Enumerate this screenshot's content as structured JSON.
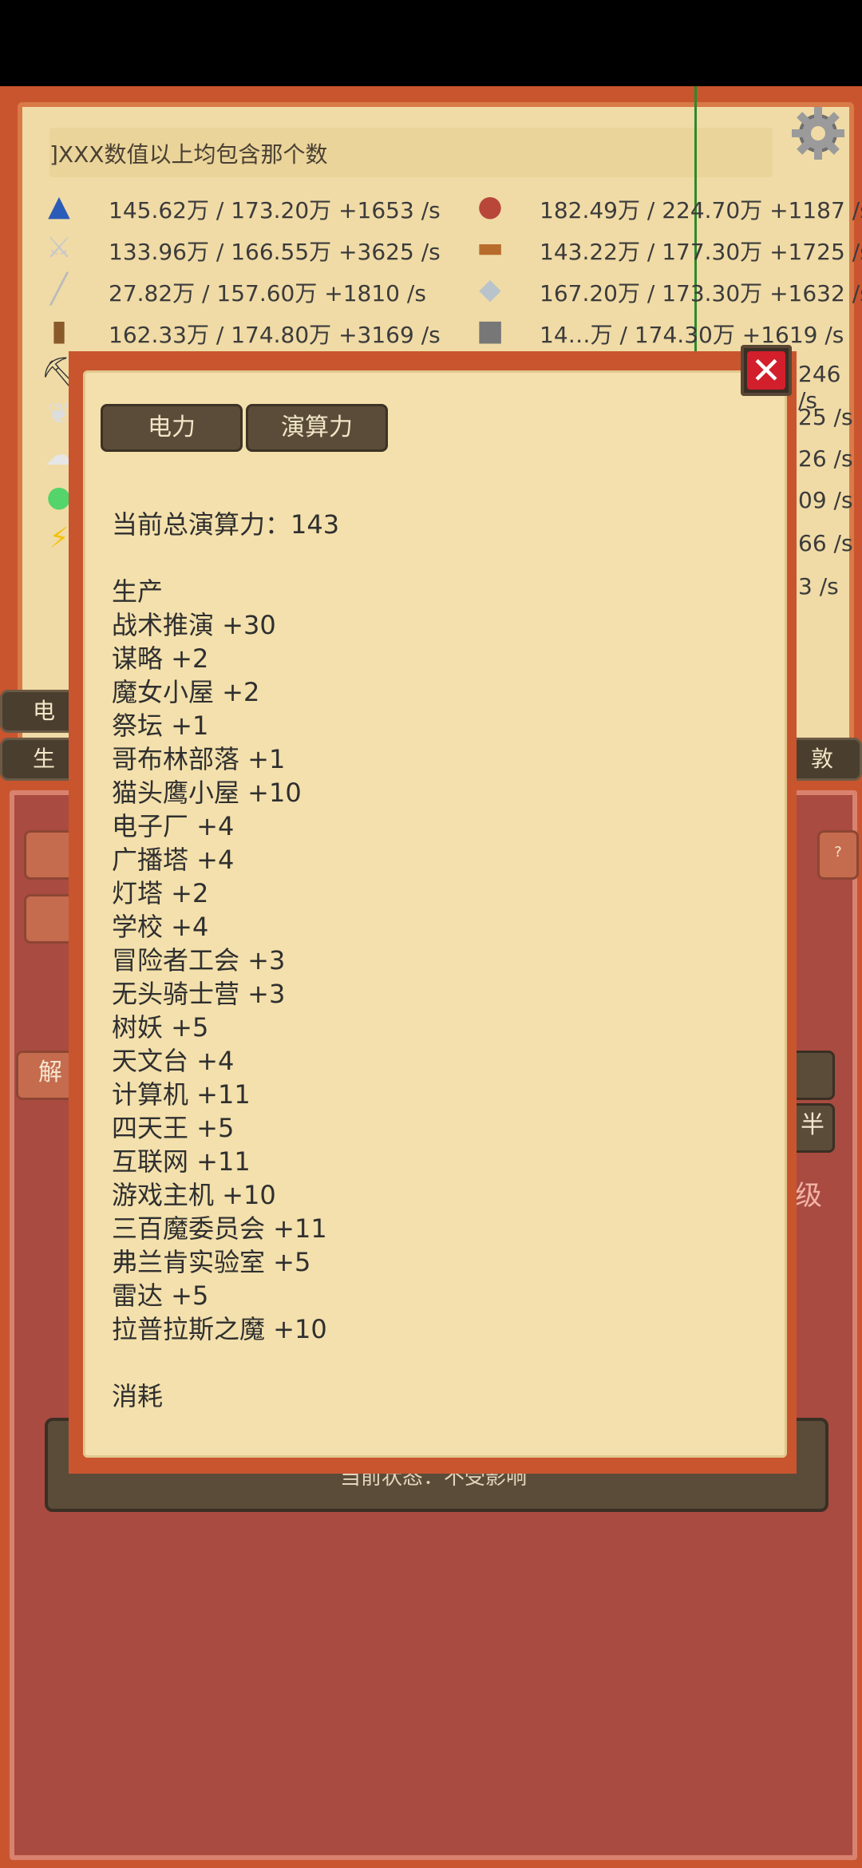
{
  "info_text": "]XXX数值以上均包含那个数",
  "left_resources": [
    {
      "icon": "wizard-hat-icon",
      "text": "145.62万 / 173.20万  +1653 /s"
    },
    {
      "icon": "sword-icon",
      "text": "133.96万 / 166.55万  +3625 /s"
    },
    {
      "icon": "wand-icon",
      "text": "27.82万 / 157.60万  +1810 /s"
    },
    {
      "icon": "book-icon",
      "text": "162.33万 / 174.80万  +3169 /s"
    }
  ],
  "right_resources": [
    {
      "icon": "meat-icon",
      "text": "182.49万 / 224.70万  +1187 /s"
    },
    {
      "icon": "wood-log-icon",
      "text": "143.22万 / 177.30万  +1725 /s"
    },
    {
      "icon": "crystal-icon",
      "text": "167.20万 / 173.30万  +1632 /s"
    },
    {
      "icon": "iron-ingot-icon",
      "text": "14…万 / 174.30万  +1619 /s"
    }
  ],
  "right_fragments": [
    "246 /s",
    "25 /s",
    "26 /s",
    "09 /s",
    "66 /s",
    "3 /s"
  ],
  "background_labels": {
    "left_tab1": "电",
    "left_tab2": "生",
    "right_tab": "敦",
    "side_char": "解",
    "right_btn": "半",
    "level": "级",
    "question": "?"
  },
  "status_text": "当前状态：不受影响",
  "modal": {
    "tabs": [
      "电力",
      "演算力"
    ],
    "total_label": "当前总演算力：143",
    "production_header": "生产",
    "production_items": [
      "战术推演 +30",
      "谋略 +2",
      "魔女小屋 +2",
      "祭坛 +1",
      "哥布林部落 +1",
      "猫头鹰小屋 +10",
      "电子厂 +4",
      "广播塔 +4",
      "灯塔 +2",
      "学校 +4",
      "冒险者工会 +3",
      "无头骑士营 +3",
      "树妖 +5",
      "天文台 +4",
      "计算机 +11",
      "四天王 +5",
      "互联网 +11",
      "游戏主机 +10",
      "三百魔委员会 +11",
      "弗兰肯实验室 +5",
      "雷达 +5",
      "拉普拉斯之魔 +10"
    ],
    "consumption_header": "消耗",
    "close_icon": "close-icon"
  }
}
